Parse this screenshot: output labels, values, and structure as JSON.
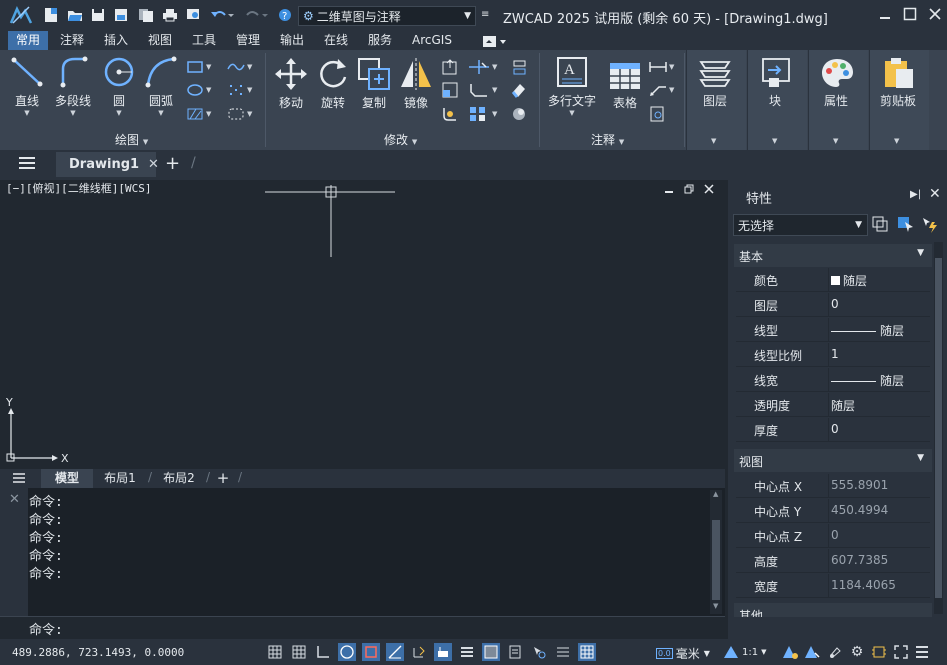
{
  "window": {
    "title": "ZWCAD 2025 试用版 (剩余 60 天) - [Drawing1.dwg]",
    "workspace": "二维草图与注释"
  },
  "tabs": [
    "常用",
    "注释",
    "插入",
    "视图",
    "工具",
    "管理",
    "输出",
    "在线",
    "服务",
    "ArcGIS"
  ],
  "ribbon": {
    "draw": {
      "line": "直线",
      "polyline": "多段线",
      "circle": "圆",
      "arc": "圆弧",
      "panel": "绘图"
    },
    "modify": {
      "move": "移动",
      "rotate": "旋转",
      "copy": "复制",
      "mirror": "镜像",
      "panel": "修改"
    },
    "annotation": {
      "mtext": "多行文字",
      "table": "表格",
      "panel": "注释"
    },
    "layers": "图层",
    "block": "块",
    "properties": "属性",
    "clipboard": "剪贴板"
  },
  "doc_tab": "Drawing1",
  "viewport": {
    "label": "[−][俯视][二维线框][WCS]",
    "y_axis": "Y",
    "x_axis": "X"
  },
  "layout_tabs": {
    "model": "模型",
    "layout1": "布局1",
    "layout2": "布局2",
    "add": "+"
  },
  "command": {
    "history": [
      "命令:",
      "命令:",
      "命令:",
      "命令:",
      "命令:"
    ],
    "prompt": "命令:"
  },
  "status": {
    "coords": "489.2886, 723.1493, 0.0000",
    "units": "毫米",
    "scale": "1:1"
  },
  "properties_panel": {
    "title": "特性",
    "selection": "无选择",
    "sections": {
      "basic": "基本",
      "view": "视图",
      "other": "其他"
    },
    "basic": [
      [
        "颜色",
        "随层"
      ],
      [
        "图层",
        "0"
      ],
      [
        "线型",
        "随层"
      ],
      [
        "线型比例",
        "1"
      ],
      [
        "线宽",
        "随层"
      ],
      [
        "透明度",
        "随层"
      ],
      [
        "厚度",
        "0"
      ]
    ],
    "view": [
      [
        "中心点 X",
        "555.8901"
      ],
      [
        "中心点 Y",
        "450.4994"
      ],
      [
        "中心点 Z",
        "0"
      ],
      [
        "高度",
        "607.7385"
      ],
      [
        "宽度",
        "1184.4065"
      ]
    ]
  },
  "colors": {
    "accent": "#3d6fa8",
    "ribbon": "#3a4451",
    "canvas": "#212830"
  }
}
